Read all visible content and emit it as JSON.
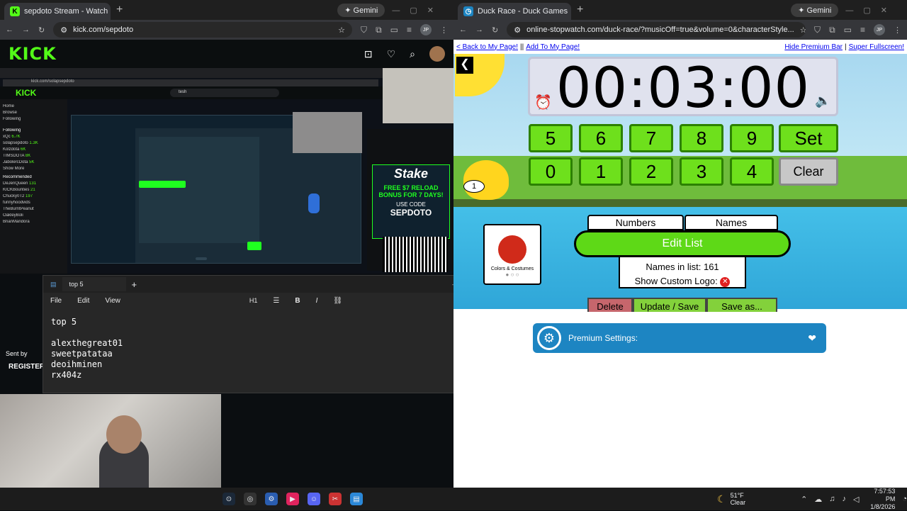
{
  "left_browser": {
    "tab_title": "sepdoto Stream - Watch Li",
    "gemini_label": "Gemini",
    "url": "kick.com/sepdoto",
    "profile": "JP"
  },
  "kick": {
    "logo": "KICK",
    "inner_url": "kick.com/solapsepdoto",
    "search_value": "tesh",
    "nav": [
      "Home",
      "Browse",
      "Following"
    ],
    "following_label": "Following",
    "following": [
      {
        "name": "xQc",
        "game": "Rocket League",
        "count": "6.7K"
      },
      {
        "name": "solapsepdoto",
        "game": "Slots & Casino",
        "count": "1.3K"
      },
      {
        "name": "Kolzdota",
        "game": "Dota 2",
        "count": "6K"
      },
      {
        "name": "TIMSDOTA",
        "game": "Dota 2",
        "count": "8K"
      },
      {
        "name": "JabolercDota",
        "game": "Dota 2",
        "count": "5K"
      }
    ],
    "show_more": "Show More",
    "recommended_label": "Recommended",
    "recommended": [
      {
        "name": "DeJenQueen",
        "game": "ARC Raiders",
        "count": "131"
      },
      {
        "name": "KICKBounties",
        "game": "KICK Bounties",
        "count": "21"
      },
      {
        "name": "Chucky0T2",
        "game": "Slots & Casino",
        "count": "197"
      },
      {
        "name": "funnyhoodvids",
        "game": "Slots & Casino",
        "count": ""
      },
      {
        "name": "TheBurntPeanut",
        "game": "ARC Raiders",
        "count": ""
      },
      {
        "name": "OakleyBoli",
        "game": "Call of Duty: Warz",
        "count": ""
      },
      {
        "name": "BrianMandora",
        "game": "",
        "count": ""
      }
    ],
    "stake_ad": {
      "brand": "Stake",
      "headline": "FREE $7 RELOAD BONUS FOR 7 DAYS!",
      "code_label": "USE CODE",
      "code": "SEPDOTO"
    },
    "sent_by": "Sent by",
    "register": "REGISTER"
  },
  "notepad": {
    "tab_title": "top 5",
    "menu": [
      "File",
      "Edit",
      "View"
    ],
    "heading_select": "H1",
    "lines": [
      "top 5",
      "",
      "alexthegreat01",
      "sweetpatataa",
      "deoihminen",
      "rx404z"
    ]
  },
  "right_browser": {
    "tab_title": "Duck Race - Duck Games",
    "gemini_label": "Gemini",
    "url": "online-stopwatch.com/duck-race/?musicOff=true&volume=0&characterStyle...",
    "profile": "JP"
  },
  "duck_race": {
    "link_back": "< Back to My Page!",
    "link_add": "Add To My Page!",
    "link_hide": "Hide Premium Bar",
    "link_fullscreen": "Super Fullscreen!",
    "timer": "00:03:00",
    "keys_row1": [
      "5",
      "6",
      "7",
      "8",
      "9"
    ],
    "keys_row2": [
      "0",
      "1",
      "2",
      "3",
      "4"
    ],
    "set_label": "Set",
    "clear_label": "Clear",
    "duck_number": "1",
    "tab_numbers": "Numbers",
    "tab_names": "Names",
    "edit_list": "Edit List",
    "names_count": "Names in list: 161",
    "show_custom_logo": "Show Custom Logo:",
    "card_label": "Colors & Costumes",
    "delete": "Delete",
    "update_save": "Update / Save",
    "save_as": "Save as...",
    "premium_settings": "Premium Settings:"
  },
  "taskbar": {
    "weather_temp": "51°F",
    "weather_desc": "Clear",
    "time": "7:57:53 PM",
    "date": "1/8/2026"
  }
}
